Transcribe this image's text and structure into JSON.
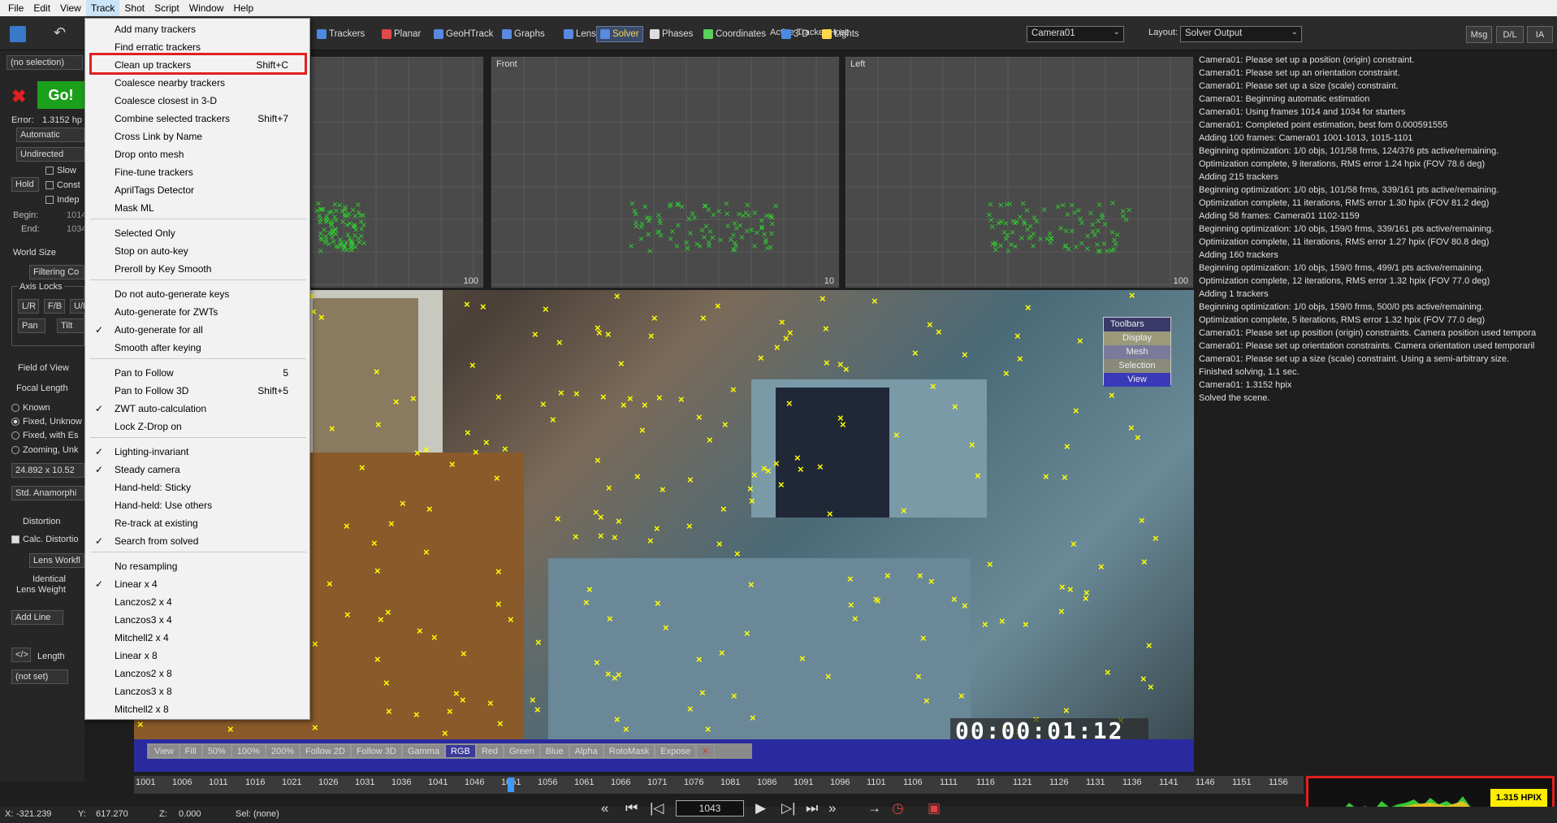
{
  "menubar": {
    "items": [
      "File",
      "Edit",
      "View",
      "Track",
      "Shot",
      "Script",
      "Window",
      "Help"
    ]
  },
  "toolbar": {
    "tabs": [
      {
        "label": "Trackers",
        "icon": "trackers-icon",
        "color": "#4a8ae0"
      },
      {
        "label": "Planar",
        "icon": "planar-icon",
        "color": "#e04a4a"
      },
      {
        "label": "GeoHTrack",
        "icon": "geohtrack-icon",
        "color": "#5a8ae0"
      },
      {
        "label": "Graphs",
        "icon": "graphs-icon",
        "color": "#5a8ae0"
      },
      {
        "label": "Lens",
        "icon": "lens-icon",
        "color": "#5a8ae0"
      },
      {
        "label": "Solver",
        "icon": "solver-icon",
        "color": "#5a8ae0"
      },
      {
        "label": "Phases",
        "icon": "phases-icon",
        "color": "#dddddd"
      },
      {
        "label": "Coordinates",
        "icon": "coordinates-icon",
        "color": "#5ad05a"
      },
      {
        "label": "3-D",
        "icon": "3d-icon",
        "color": "#4a8ae0"
      },
      {
        "label": "Lights",
        "icon": "lights-icon",
        "color": "#ffd84a"
      }
    ],
    "host_label": "Active Tracker Host:",
    "host_value": "Camera01",
    "layout_label": "Layout:",
    "layout_value": "Solver Output",
    "msg": "Msg",
    "dl": "D/L",
    "ia": "IA"
  },
  "left": {
    "selection": "(no selection)",
    "go": "Go!",
    "error_label": "Error:",
    "error_value": "1.3152 hp",
    "mode": "Automatic",
    "direction": "Undirected",
    "slow": "Slow",
    "const": "Const",
    "indep": "Indep",
    "hold": "Hold",
    "begin_label": "Begin:",
    "begin_value": "1014",
    "end_label": "End:",
    "end_value": "1034",
    "world_size": "World Size",
    "filtering": "Filtering Co",
    "axis_locks": "Axis Locks",
    "lr": "L/R",
    "fb": "F/B",
    "ud": "U/D",
    "pan": "Pan",
    "tilt": "Tilt",
    "fov": "Field of View",
    "focal": "Focal Length",
    "known": "Known",
    "fixed_unknown": "Fixed, Unknow",
    "fixed_est": "Fixed, with Es",
    "zooming": "Zooming, Unk",
    "back_size": "24.892 x 10.52",
    "anamorphic": "Std. Anamorphi",
    "distortion": "Distortion",
    "calc_distortion": "Calc. Distortio",
    "lens_workflow": "Lens Workfl",
    "identical": "Identical",
    "lens_weight": "Lens Weight",
    "add_line": "Add Line",
    "length": "Length",
    "not_set": "(not set)"
  },
  "viewports": [
    {
      "name": "Front",
      "scale": "10"
    },
    {
      "name": "Left",
      "scale": "100"
    },
    {
      "name": "",
      "scale": "100"
    }
  ],
  "log": [
    "Camera01: Please set up a position (origin) constraint.",
    "Camera01: Please set up an orientation constraint.",
    "Camera01: Please set up a size (scale) constraint.",
    "Camera01: Beginning automatic estimation",
    "Camera01: Using frames 1014 and 1034 for starters",
    "Camera01: Completed point estimation, best fom 0.000591555",
    "Adding 100 frames:  Camera01 1001-1013, 1015-1101",
    "Beginning optimization: 1/0 objs, 101/58 frms, 124/376 pts active/remaining.",
    "Optimization complete, 9 iterations, RMS error 1.24 hpix (FOV 78.6 deg)",
    "Adding 215 trackers",
    "Beginning optimization: 1/0 objs, 101/58 frms, 339/161 pts active/remaining.",
    "Optimization complete, 11 iterations, RMS error 1.30 hpix (FOV 81.2 deg)",
    "Adding 58 frames:  Camera01 1102-1159",
    "Beginning optimization: 1/0 objs, 159/0 frms, 339/161 pts active/remaining.",
    "Optimization complete, 11 iterations, RMS error 1.27 hpix (FOV 80.8 deg)",
    "Adding 160 trackers",
    "Beginning optimization: 1/0 objs, 159/0 frms, 499/1 pts active/remaining.",
    "Optimization complete, 12 iterations, RMS error 1.32 hpix (FOV 77.0 deg)",
    "Adding 1 trackers",
    "Beginning optimization: 1/0 objs, 159/0 frms, 500/0 pts active/remaining.",
    "Optimization complete, 5 iterations, RMS error 1.32 hpix (FOV 77.0 deg)",
    "Camera01: Please set up position (origin) constraints. Camera position used tempora",
    "Camera01: Please set up orientation constraints. Camera orientation used temporaril",
    "Camera01: Please set up a size (scale) constraint. Using a semi-arbitrary size.",
    "Finished solving, 1.1 sec.",
    "Camera01: 1.3152 hpix",
    "Solved the scene."
  ],
  "main": {
    "timecode": "00:00:01:12",
    "toolbars_title": "Toolbars",
    "toolbars": [
      "Display",
      "Mesh",
      "Selection",
      "View"
    ],
    "viewbar": [
      "View",
      "Fill",
      "50%",
      "100%",
      "200%",
      "Follow 2D",
      "Follow 3D",
      "Gamma",
      "RGB",
      "Red",
      "Green",
      "Blue",
      "Alpha",
      "RotoMask",
      "Expose"
    ]
  },
  "timebar": {
    "ticks": [
      "1001",
      "1006",
      "1011",
      "1016",
      "1021",
      "1026",
      "1031",
      "1036",
      "1041",
      "1046",
      "1051",
      "1056",
      "1061",
      "1066",
      "1071",
      "1076",
      "1081",
      "1086",
      "1091",
      "1096",
      "1101",
      "1106",
      "1111",
      "1116",
      "1121",
      "1126",
      "1131",
      "1136",
      "1141",
      "1146",
      "1151",
      "1156"
    ]
  },
  "status": {
    "x_label": "X:",
    "x": "-321.239",
    "y_label": "Y:",
    "y": "617.270",
    "z_label": "Z:",
    "z": "0.000",
    "sel": "Sel: (none)",
    "frame": "1043",
    "hpix": "1.315 HPIX"
  },
  "menu": {
    "items": [
      {
        "label": "Add many trackers",
        "shortcut": "",
        "checked": false
      },
      {
        "label": "Find erratic trackers",
        "shortcut": "",
        "checked": false
      },
      {
        "label": "Clean up trackers",
        "shortcut": "Shift+C",
        "checked": false
      },
      {
        "label": "Coalesce nearby trackers",
        "shortcut": "",
        "checked": false
      },
      {
        "label": "Coalesce closest in 3-D",
        "shortcut": "",
        "checked": false
      },
      {
        "label": "Combine selected trackers",
        "shortcut": "Shift+7",
        "checked": false
      },
      {
        "label": "Cross Link by Name",
        "shortcut": "",
        "checked": false
      },
      {
        "label": "Drop onto mesh",
        "shortcut": "",
        "checked": false
      },
      {
        "label": "Fine-tune trackers",
        "shortcut": "",
        "checked": false
      },
      {
        "label": "AprilTags Detector",
        "shortcut": "",
        "checked": false
      },
      {
        "label": "Mask ML",
        "shortcut": "",
        "checked": false
      },
      {
        "sep": true
      },
      {
        "label": "Selected Only",
        "shortcut": "",
        "checked": false
      },
      {
        "label": "Stop on auto-key",
        "shortcut": "",
        "checked": false
      },
      {
        "label": "Preroll by Key Smooth",
        "shortcut": "",
        "checked": false
      },
      {
        "sep": true
      },
      {
        "label": "Do not auto-generate keys",
        "shortcut": "",
        "checked": false
      },
      {
        "label": "Auto-generate for ZWTs",
        "shortcut": "",
        "checked": false
      },
      {
        "label": "Auto-generate for all",
        "shortcut": "",
        "checked": true
      },
      {
        "label": "Smooth after keying",
        "shortcut": "",
        "checked": false
      },
      {
        "sep": true
      },
      {
        "label": "Pan to Follow",
        "shortcut": "5",
        "checked": false
      },
      {
        "label": "Pan to Follow 3D",
        "shortcut": "Shift+5",
        "checked": false
      },
      {
        "label": "ZWT auto-calculation",
        "shortcut": "",
        "checked": true
      },
      {
        "label": "Lock Z-Drop on",
        "shortcut": "",
        "checked": false
      },
      {
        "sep": true
      },
      {
        "label": "Lighting-invariant",
        "shortcut": "",
        "checked": true
      },
      {
        "label": "Steady camera",
        "shortcut": "",
        "checked": true
      },
      {
        "label": "Hand-held: Sticky",
        "shortcut": "",
        "checked": false
      },
      {
        "label": "Hand-held: Use others",
        "shortcut": "",
        "checked": false
      },
      {
        "label": "Re-track at existing",
        "shortcut": "",
        "checked": false
      },
      {
        "label": "Search from solved",
        "shortcut": "",
        "checked": true
      },
      {
        "sep": true
      },
      {
        "label": "No resampling",
        "shortcut": "",
        "checked": false
      },
      {
        "label": "Linear x 4",
        "shortcut": "",
        "checked": true
      },
      {
        "label": "Lanczos2 x 4",
        "shortcut": "",
        "checked": false
      },
      {
        "label": "Lanczos3 x 4",
        "shortcut": "",
        "checked": false
      },
      {
        "label": "Mitchell2 x 4",
        "shortcut": "",
        "checked": false
      },
      {
        "label": "Linear x 8",
        "shortcut": "",
        "checked": false
      },
      {
        "label": "Lanczos2 x 8",
        "shortcut": "",
        "checked": false
      },
      {
        "label": "Lanczos3 x 8",
        "shortcut": "",
        "checked": false
      },
      {
        "label": "Mitchell2 x 8",
        "shortcut": "",
        "checked": false
      }
    ]
  }
}
